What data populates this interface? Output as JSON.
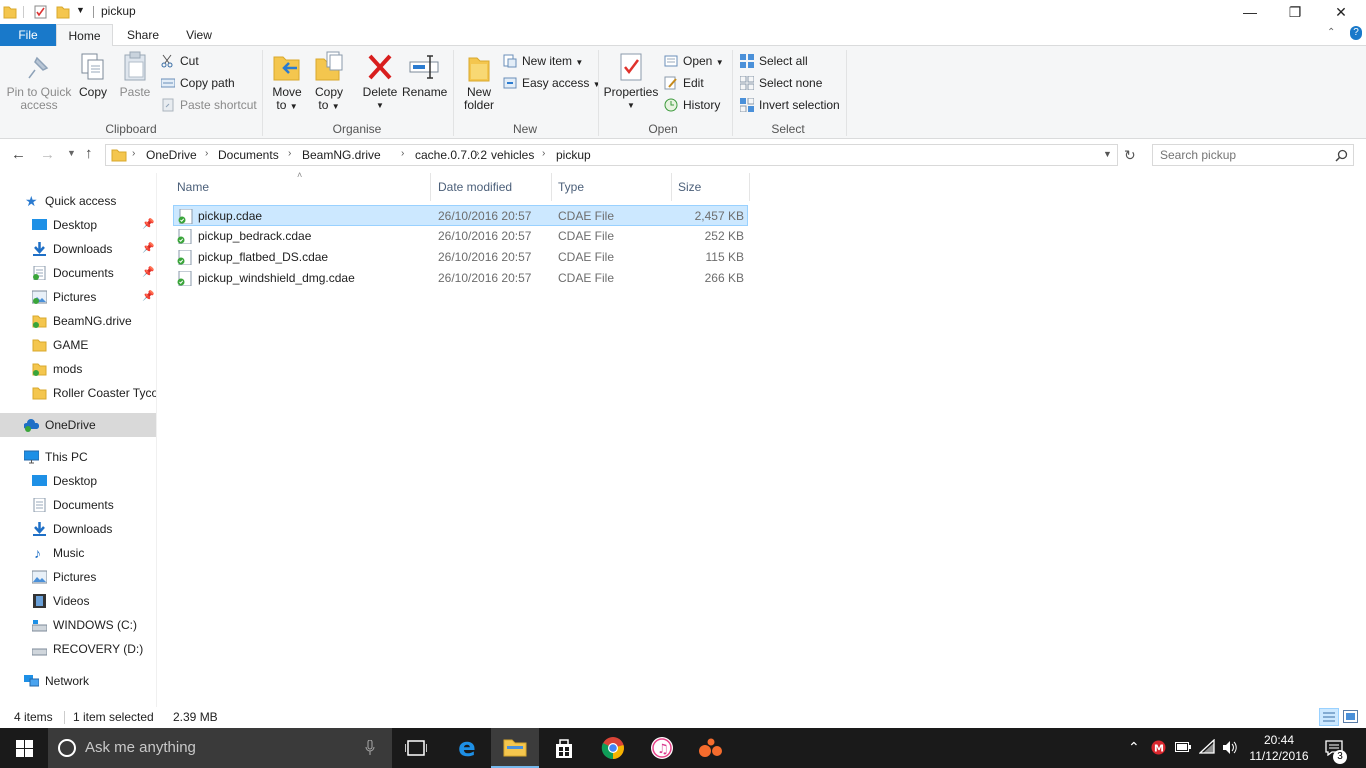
{
  "window": {
    "title": "pickup",
    "minimize_glyph": "—",
    "restore_glyph": "❐",
    "close_glyph": "✕"
  },
  "tabs": {
    "file": "File",
    "home": "Home",
    "share": "Share",
    "view": "View"
  },
  "ribbon": {
    "clipboard": {
      "label": "Clipboard",
      "pin_line1": "Pin to Quick",
      "pin_line2": "access",
      "copy": "Copy",
      "paste": "Paste",
      "cut": "Cut",
      "copy_path": "Copy path",
      "paste_shortcut": "Paste shortcut"
    },
    "organise": {
      "label": "Organise",
      "move_line1": "Move",
      "move_line2": "to",
      "copy_line1": "Copy",
      "copy_line2": "to",
      "delete": "Delete",
      "rename": "Rename"
    },
    "new": {
      "label": "New",
      "folder_line1": "New",
      "folder_line2": "folder",
      "new_item": "New item",
      "easy_access": "Easy access"
    },
    "open": {
      "label": "Open",
      "properties": "Properties",
      "open": "Open",
      "edit": "Edit",
      "history": "History"
    },
    "select": {
      "label": "Select",
      "select_all": "Select all",
      "select_none": "Select none",
      "invert": "Invert selection"
    }
  },
  "address": {
    "crumbs": [
      "OneDrive",
      "Documents",
      "BeamNG.drive",
      "cache.0.7.0.2",
      "vehicles",
      "pickup"
    ],
    "search_placeholder": "Search pickup"
  },
  "nav": {
    "quick_access": "Quick access",
    "quick_items": [
      "Desktop",
      "Downloads",
      "Documents",
      "Pictures",
      "BeamNG.drive",
      "GAME",
      "mods",
      "Roller Coaster Tycoon"
    ],
    "onedrive": "OneDrive",
    "this_pc": "This PC",
    "pc_items": [
      "Desktop",
      "Documents",
      "Downloads",
      "Music",
      "Pictures",
      "Videos",
      "WINDOWS (C:)",
      "RECOVERY (D:)"
    ],
    "network": "Network"
  },
  "columns": {
    "name": "Name",
    "date": "Date modified",
    "type": "Type",
    "size": "Size"
  },
  "files": [
    {
      "name": "pickup.cdae",
      "date": "26/10/2016 20:57",
      "type": "CDAE File",
      "size": "2,457 KB"
    },
    {
      "name": "pickup_bedrack.cdae",
      "date": "26/10/2016 20:57",
      "type": "CDAE File",
      "size": "252 KB"
    },
    {
      "name": "pickup_flatbed_DS.cdae",
      "date": "26/10/2016 20:57",
      "type": "CDAE File",
      "size": "115 KB"
    },
    {
      "name": "pickup_windshield_dmg.cdae",
      "date": "26/10/2016 20:57",
      "type": "CDAE File",
      "size": "266 KB"
    }
  ],
  "status": {
    "count": "4 items",
    "selected": "1 item selected",
    "size": "2.39 MB"
  },
  "taskbar": {
    "search_placeholder": "Ask me anything",
    "time": "20:44",
    "date": "11/12/2016",
    "notifications": "3"
  },
  "colors": {
    "accent": "#1979ca",
    "selection": "#cce8ff",
    "folder": "#f4c64e"
  }
}
